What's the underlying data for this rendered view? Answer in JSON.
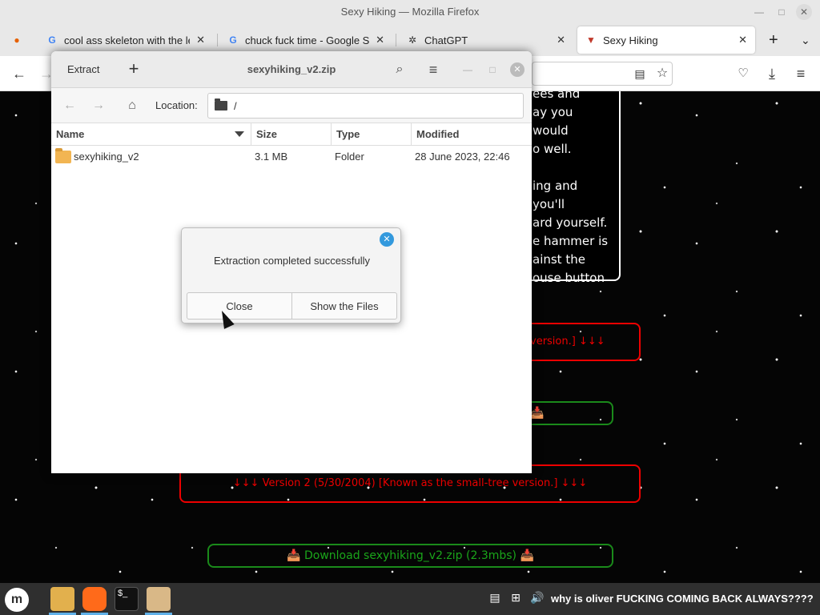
{
  "firefox": {
    "window_title": "Sexy Hiking — Mozilla Firefox",
    "tabs": [
      {
        "title": "cool ass skeleton with the le",
        "favicon": "google-icon"
      },
      {
        "title": "chuck fuck time - Google Se",
        "favicon": "google-icon"
      },
      {
        "title": "ChatGPT",
        "favicon": "openai-icon"
      },
      {
        "title": "Sexy Hiking",
        "favicon": "sexy-hiking-favicon"
      }
    ]
  },
  "page": {
    "text_box_lines": [
      "ees and",
      "ay you would",
      "o well.",
      "",
      "ing and you'll",
      "ard yourself.",
      "e hammer is",
      "ainst the",
      "ouse button"
    ],
    "pill_red_1": "version.] ↓↓↓",
    "pill_green_1": "📥",
    "pill_red_2": "↓↓↓ Version 2 (5/30/2004) [Known as the small-tree version.] ↓↓↓",
    "pill_green_2": "📥 Download sexyhiking_v2.zip (2.3mbs) 📥"
  },
  "archive_window": {
    "extract_label": "Extract",
    "title": "sexyhiking_v2.zip",
    "location_label": "Location:",
    "location_value": "/",
    "columns": [
      "Name",
      "Size",
      "Type",
      "Modified"
    ],
    "rows": [
      {
        "name": "sexyhiking_v2",
        "size": "3.1 MB",
        "type": "Folder",
        "modified": "28 June 2023, 22:46"
      }
    ]
  },
  "dialog": {
    "message": "Extraction completed successfully",
    "close_label": "Close",
    "show_files_label": "Show the Files"
  },
  "taskbar": {
    "status_text": "why is oliver FUCKING COMING BACK ALWAYS????"
  },
  "colors": {
    "link_red": "#e00000",
    "link_green": "#1aa51a",
    "dialog_close_blue": "#3399dd"
  }
}
